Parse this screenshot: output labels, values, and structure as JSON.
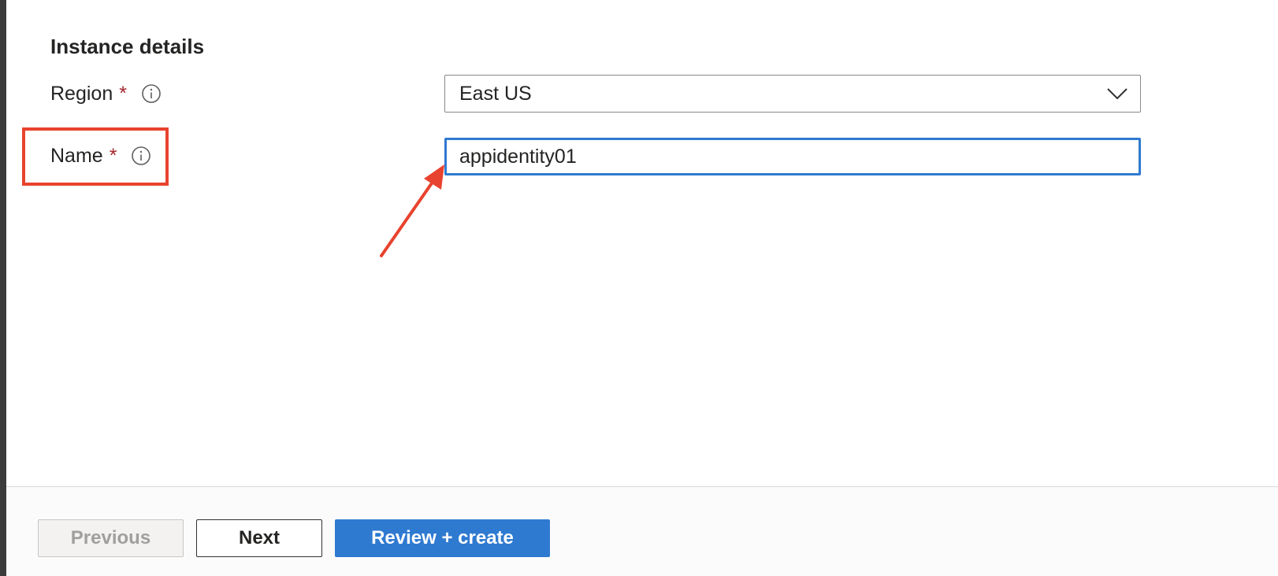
{
  "section": {
    "title": "Instance details"
  },
  "fields": {
    "region": {
      "label": "Region",
      "required_marker": "*",
      "info_icon": "info-circle-icon",
      "value": "East US",
      "dropdown_icon": "chevron-down-icon"
    },
    "name": {
      "label": "Name",
      "required_marker": "*",
      "info_icon": "info-circle-icon",
      "value": "appidentity01",
      "highlighted": true
    }
  },
  "footer": {
    "previous_label": "Previous",
    "previous_disabled": true,
    "next_label": "Next",
    "review_label": "Review + create"
  },
  "colors": {
    "accent": "#2f7ad1",
    "required": "#a4262c",
    "annotation": "#e8432e"
  }
}
